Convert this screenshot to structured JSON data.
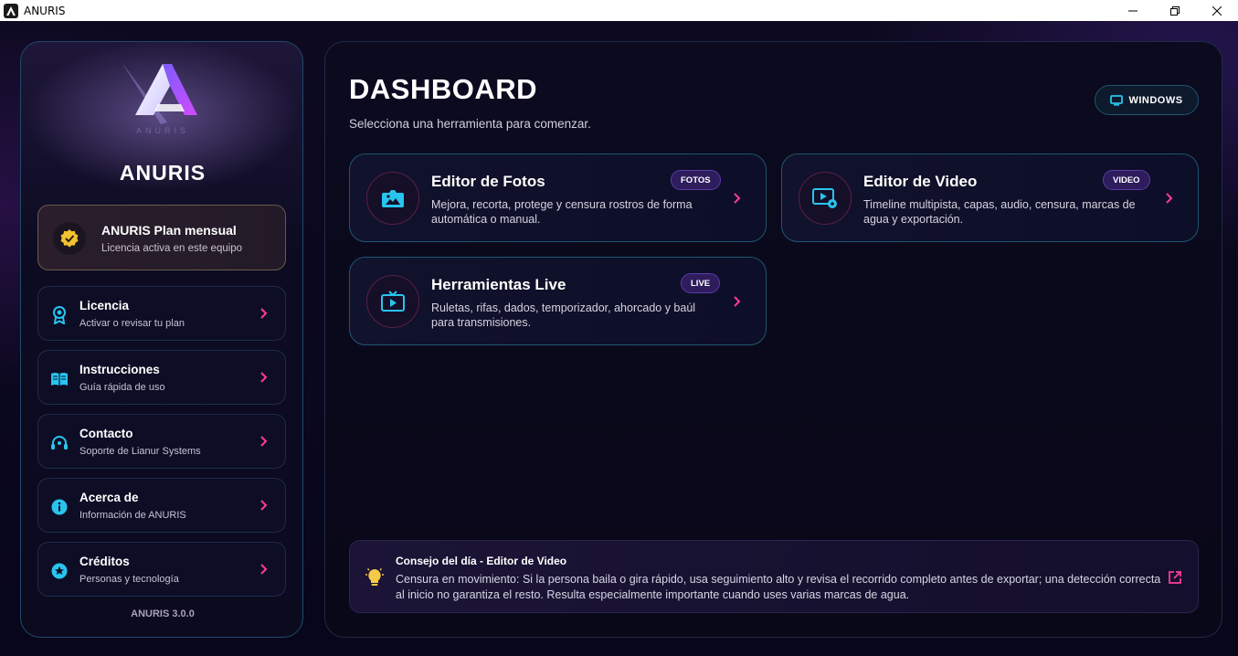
{
  "window": {
    "title": "ANURIS"
  },
  "sidebar": {
    "brand": "ANURIS",
    "logo_caption": "ANURIS",
    "plan": {
      "title": "ANURIS Plan mensual",
      "subtitle": "Licencia activa en este equipo"
    },
    "items": [
      {
        "title": "Licencia",
        "subtitle": "Activar o revisar tu plan",
        "icon": "award-icon"
      },
      {
        "title": "Instrucciones",
        "subtitle": "Guía rápida de uso",
        "icon": "book-icon"
      },
      {
        "title": "Contacto",
        "subtitle": "Soporte de Lianur Systems",
        "icon": "headset-icon"
      },
      {
        "title": "Acerca de",
        "subtitle": "Información de ANURIS",
        "icon": "info-icon"
      },
      {
        "title": "Créditos",
        "subtitle": "Personas y tecnología",
        "icon": "star-icon"
      }
    ],
    "version": "ANURIS 3.0.0"
  },
  "main": {
    "title": "DASHBOARD",
    "subtitle": "Selecciona una herramienta para comenzar.",
    "platform_button": "WINDOWS",
    "cards": [
      {
        "title": "Editor de Fotos",
        "tag": "FOTOS",
        "description": "Mejora, recorta, protege y censura rostros de forma automática o manual.",
        "icon": "image-icon"
      },
      {
        "title": "Editor de Video",
        "tag": "VIDEO",
        "description": "Timeline multipista, capas, audio, censura, marcas de agua y exportación.",
        "icon": "video-settings-icon"
      },
      {
        "title": "Herramientas Live",
        "tag": "LIVE",
        "description": "Ruletas, rifas, dados, temporizador, ahorcado y baúl para transmisiones.",
        "icon": "live-tv-icon"
      }
    ],
    "tip": {
      "title": "Consejo del día - Editor de Video",
      "body": "Censura en movimiento: Si la persona baila o gira rápido, usa seguimiento alto y revisa el recorrido completo antes de exportar; una detección correcta al inicio no garantiza el resto. Resulta especialmente importante cuando uses varias marcas de agua."
    }
  },
  "colors": {
    "accent_pink": "#ff3c96",
    "accent_cyan": "#28c4ee",
    "gold": "#f2c230",
    "tag_purple": "#2e1c5c"
  }
}
